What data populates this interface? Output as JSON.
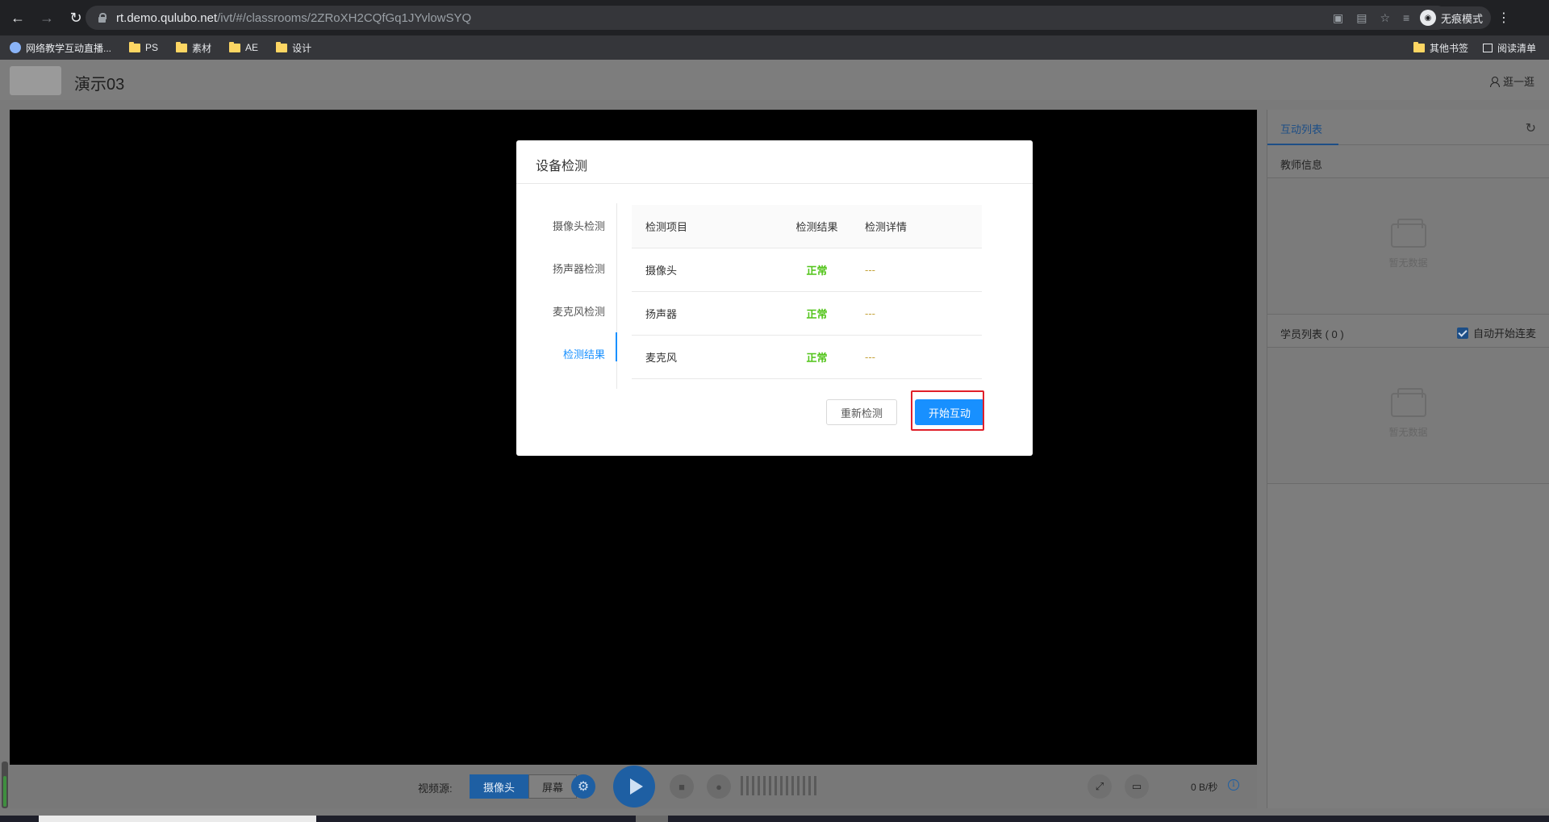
{
  "browser": {
    "url_host": "rt.demo.qulubo.net",
    "url_path": "/ivt/#/classrooms/2ZRoXH2CQfGq1JYvlowSYQ",
    "incognito_label": "无痕模式",
    "bookmarks": [
      "网络教学互动直播...",
      "PS",
      "素材",
      "AE",
      "设计"
    ],
    "other_bookmarks": "其他书签",
    "reading_list": "阅读清单"
  },
  "header": {
    "room_title": "演示03",
    "user_label": "逛一逛"
  },
  "controls": {
    "video_source_label": "视频源:",
    "source_camera": "摄像头",
    "source_screen": "屏幕",
    "rate": "0 B/秒"
  },
  "side_panel": {
    "tab_label": "互动列表",
    "teacher_info": "教师信息",
    "empty_text": "暂无数据",
    "student_list": "学员列表 ( 0 )",
    "auto_connect": "自动开始连麦",
    "student_empty_text": "暂无数据"
  },
  "modal": {
    "title": "设备检测",
    "nav": [
      "摄像头检测",
      "扬声器检测",
      "麦克风检测",
      "检测结果"
    ],
    "active_nav": "检测结果",
    "table_headers": [
      "检测项目",
      "检测结果",
      "检测详情"
    ],
    "rows": [
      {
        "item": "摄像头",
        "result": "正常",
        "detail": "---"
      },
      {
        "item": "扬声器",
        "result": "正常",
        "detail": "---"
      },
      {
        "item": "麦克风",
        "result": "正常",
        "detail": "---"
      }
    ],
    "recheck_button": "重新检测",
    "start_button": "开始互动"
  },
  "colors": {
    "accent": "#1890ff",
    "ok": "#52c41a",
    "highlight": "#e0202a"
  }
}
